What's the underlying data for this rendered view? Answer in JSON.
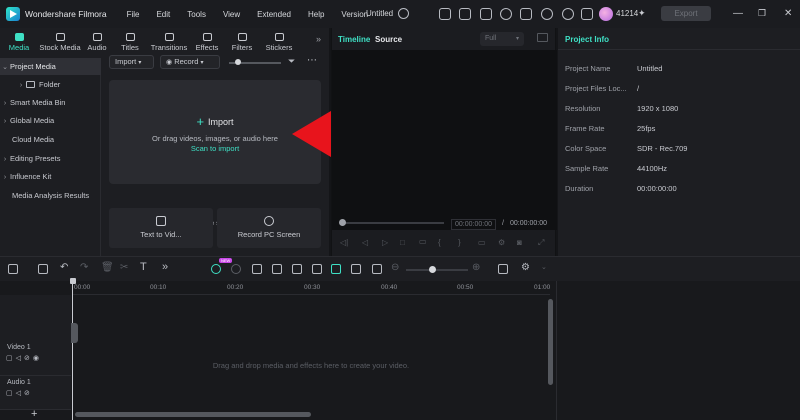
{
  "app": {
    "name": "Wondershare Filmora",
    "menu": [
      "File",
      "Edit",
      "Tools",
      "View",
      "Extended",
      "Help",
      "Version"
    ],
    "doc_title": "Untitled",
    "credits": "41214",
    "export_label": "Export"
  },
  "media_tabs": [
    "Media",
    "Stock Media",
    "Audio",
    "Titles",
    "Transitions",
    "Effects",
    "Filters",
    "Stickers"
  ],
  "sidebar": {
    "items": [
      {
        "label": "Project Media"
      },
      {
        "label": "Folder"
      },
      {
        "label": "Smart Media Bin"
      },
      {
        "label": "Global Media"
      },
      {
        "label": "Cloud Media"
      },
      {
        "label": "Editing Presets"
      },
      {
        "label": "Influence Kit"
      },
      {
        "label": "Media Analysis Results"
      }
    ]
  },
  "media": {
    "import_dropdown": "Import",
    "record_dropdown": "Record",
    "import_label": "Import",
    "drop_hint": "Or drag videos, images, or audio here",
    "scan_link": "Scan to import",
    "no_files_text": "No media files yet? Create some now with these tools",
    "tool_text_to_video": "Text to Vid...",
    "tool_record_pc": "Record PC Screen"
  },
  "player": {
    "tab_timeline": "Timeline",
    "tab_source": "Source",
    "quality": "Full",
    "current_time": "00:00:00:00",
    "separator": "/",
    "total_time": "00:00:00:00"
  },
  "project_info": {
    "title": "Project Info",
    "rows": [
      {
        "label": "Project Name",
        "value": "Untitled"
      },
      {
        "label": "Project Files Loc...",
        "value": "/"
      },
      {
        "label": "Resolution",
        "value": "1920 x 1080"
      },
      {
        "label": "Frame Rate",
        "value": "25fps"
      },
      {
        "label": "Color Space",
        "value": "SDR - Rec.709"
      },
      {
        "label": "Sample Rate",
        "value": "44100Hz"
      },
      {
        "label": "Duration",
        "value": "00:00:00:00"
      }
    ]
  },
  "timeline": {
    "ticks": [
      "00:00",
      "00:10",
      "00:20",
      "00:30",
      "00:40",
      "00:50",
      "01:00"
    ],
    "tracks": [
      {
        "name": "Video 1"
      },
      {
        "name": "Audio 1"
      }
    ],
    "empty_hint": "Drag and drop media and effects here to create your video.",
    "add_track": "+"
  },
  "colors": {
    "accent": "#3fe0c5",
    "arrow": "#e8141c",
    "background": "#141518"
  }
}
